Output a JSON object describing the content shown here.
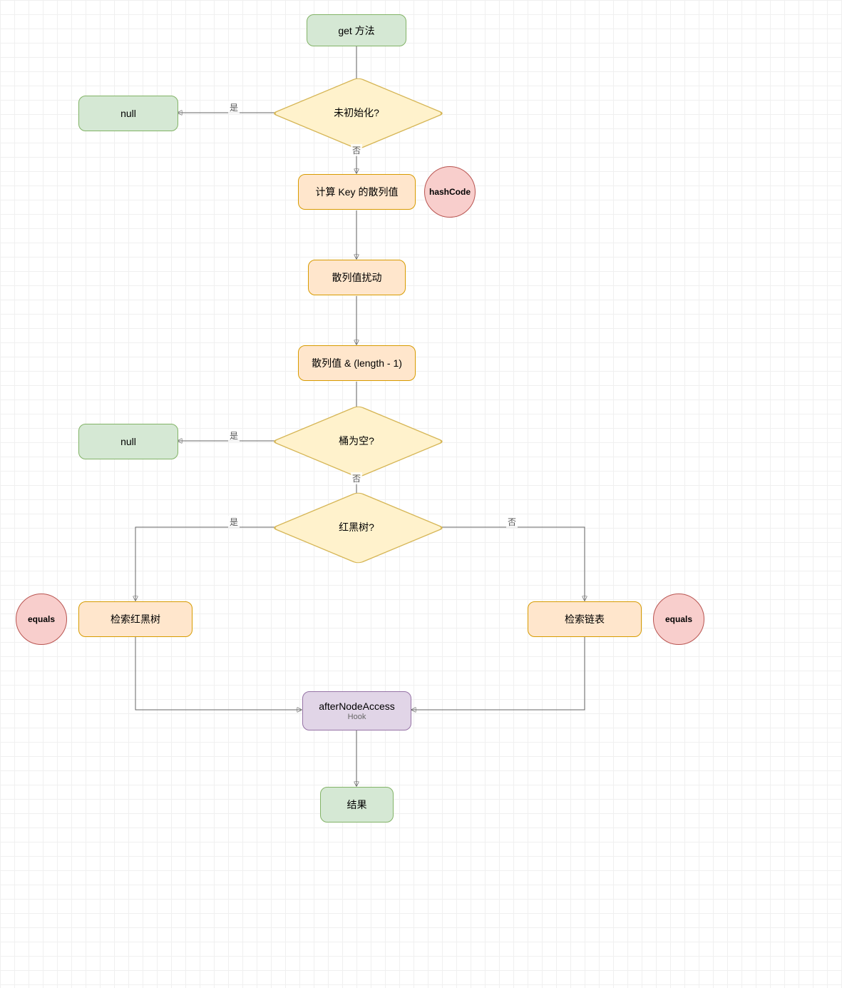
{
  "nodes": {
    "start": "get 方法",
    "notInit": "未初始化?",
    "null1": "null",
    "computeHash": "计算 Key 的散列值",
    "hashcode": "hashCode",
    "perturb": "散列值扰动",
    "indexCalc": "散列值 & (length - 1)",
    "bucketEmpty": "桶为空?",
    "null2": "null",
    "isRBTree": "红黑树?",
    "searchRBTree": "检索红黑树",
    "equals1": "equals",
    "searchList": "检索链表",
    "equals2": "equals",
    "afterAccess": "afterNodeAccess",
    "hook": "Hook",
    "result": "结果"
  },
  "labels": {
    "yes": "是",
    "no": "否"
  }
}
